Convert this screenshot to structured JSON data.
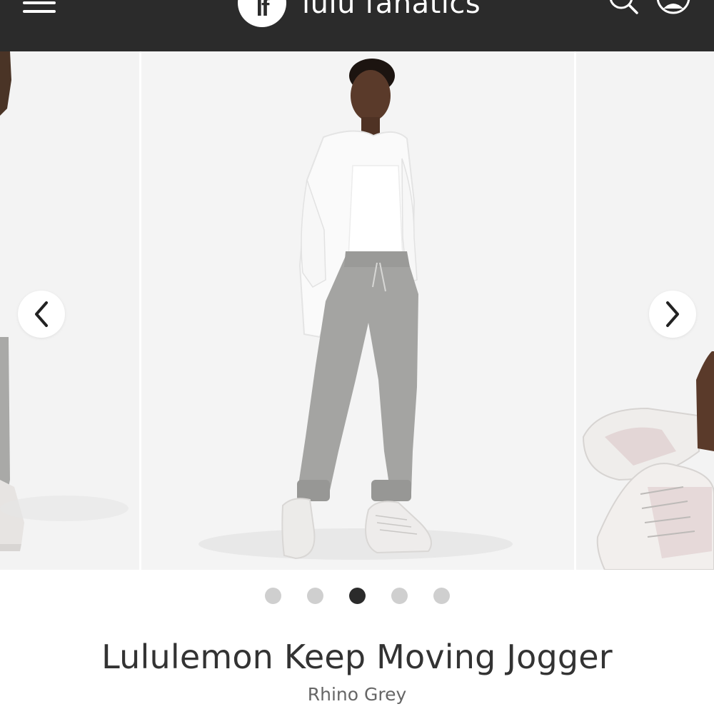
{
  "header": {
    "logo_text": "lf",
    "brand_name": "lulu fanatics",
    "icons": {
      "menu": "hamburger-menu-icon",
      "search": "search-icon",
      "account": "user-account-icon"
    }
  },
  "carousel": {
    "icons": {
      "prev": "chevron-left-icon",
      "next": "chevron-right-icon"
    },
    "slide_count": 5,
    "active_index": 3
  },
  "product": {
    "title": "Lululemon Keep Moving Jogger",
    "color": "Rhino Grey"
  },
  "colors": {
    "header_bg": "#2b2b2b",
    "dot_active": "#2b2b2b",
    "dot_inactive": "#cfcfcf",
    "jogger_grey": "#a4a4a2"
  }
}
